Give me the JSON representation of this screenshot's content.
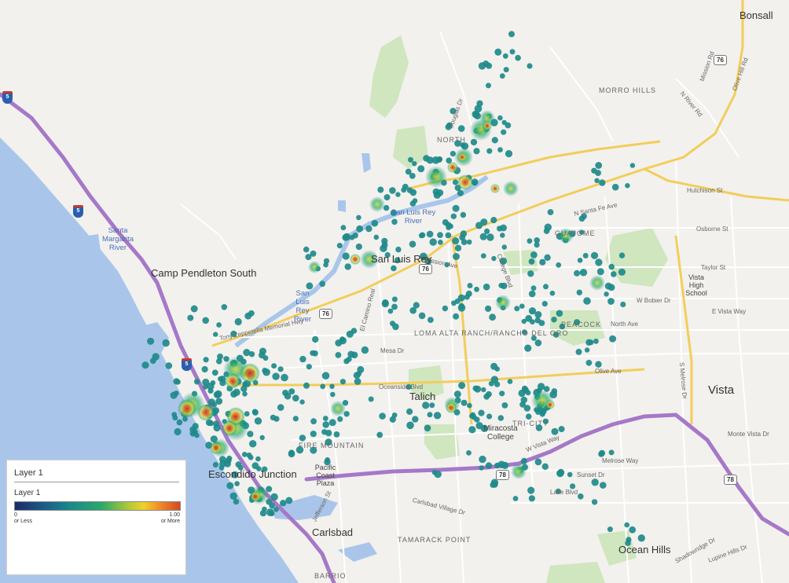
{
  "places": {
    "bonsall": "Bonsall",
    "camp_pendleton_south": "Camp Pendleton South",
    "san_luis_rey": "San Luis Rey",
    "vista": "Vista",
    "talich": "Talich",
    "escondido_junction": "Escondido Junction",
    "carlsbad": "Carlsbad",
    "ocean_hills": "Ocean Hills",
    "miracosta_college": "Miracosta College",
    "vista_high_school": "Vista High School",
    "pacific_coast_plaza": "Pacific Coast Plaza"
  },
  "neighborhoods": {
    "morro_hills": "MORRO HILLS",
    "north": "NORTH",
    "guajome": "GUAJOME",
    "peacock": "PEACOCK",
    "loma_alta": "LOMA ALTA RANCH/RANCHO DEL ORO",
    "fire_mountain": "FIRE MOUNTAIN",
    "tri_city": "TRI-CITY",
    "tamarack_point": "TAMARACK POINT",
    "barrio": "BARRIO"
  },
  "water": {
    "santa_margarita": "Santa Margarita River",
    "san_luis_rey_river": "San Luis Rey River",
    "san_luis_rey_river_2": "San Luis Rey River"
  },
  "shields": {
    "i5_a": "5",
    "i5_b": "5",
    "i5_c": "5",
    "sr76_a": "76",
    "sr76_b": "76",
    "sr76_c": "76",
    "sr78_a": "78",
    "sr78_b": "78"
  },
  "streets": {
    "mission_ave": "Mission Ave",
    "oceanside_blvd": "Oceanside Blvd",
    "mesa_dr": "Mesa Dr",
    "olive_ave": "Olive Ave",
    "north_ave": "North Ave",
    "melrose_way": "Melrose Way",
    "sunset_dr": "Sunset Dr",
    "lake_blvd": "Lake Blvd",
    "osborne_st": "Osborne St",
    "taylor_st": "Taylor St",
    "hutchison_st": "Hutchison St",
    "bobier_dr": "W Bobier Dr",
    "n_santa_fe_ave": "N Santa Fe Ave",
    "e_vista_way": "E Vista Way",
    "s_melrose_dr": "S Melrose Dr",
    "monte_vista_dr": "Monte Vista Dr",
    "carlsbad_village_dr": "Carlsbad Village Dr",
    "el_camino_real": "El Camino Real",
    "college_blvd": "College Blvd",
    "douglas_dr": "Douglas Dr",
    "n_river_rd": "N River Rd",
    "olive_hill_rd": "Olive Hill Rd",
    "mission_rd": "Mission Rd",
    "tony_zeppetella": "Tony Zeppetella Memorial Hwy",
    "oceanside_hwy": "Oceanside Blvd",
    "vista_way": "W Vista Way",
    "jefferson_st": "Jefferson St",
    "lupine_hills": "Lupine Hills Dr",
    "shadowridge": "Shadowridge Dr"
  },
  "legend": {
    "title": "Layer 1",
    "layer_name": "Layer 1",
    "min_value": "0",
    "min_text": "or Less",
    "max_value": "1.00",
    "max_text": "or More",
    "gradient": [
      "#1a2a6b",
      "#1d5d86",
      "#1a8a8a",
      "#2aa86a",
      "#a8c83a",
      "#f0d02a",
      "#f08a2a",
      "#d04a20"
    ]
  },
  "heatmap": {
    "layer_name": "Layer 1",
    "value_min": 0,
    "value_max": 1.0,
    "dot_color": "#1f8a8a",
    "hot_colors": [
      "#2ab06a",
      "#d8d43a",
      "#e0782a",
      "#c8321e"
    ]
  },
  "colors": {
    "land": "#f2f1ee",
    "ocean": "#a9c6ea",
    "park": "#cfe6bf",
    "freeway": "#a678c8",
    "highway": "#f3cd5a",
    "road": "#ffffff"
  }
}
